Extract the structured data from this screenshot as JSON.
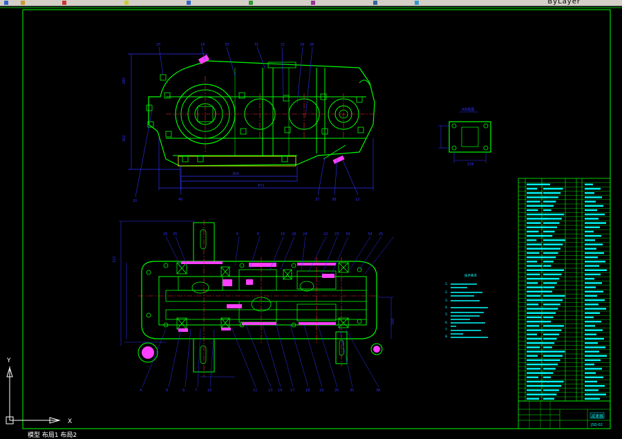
{
  "app": {
    "tab_label": "模型 布局1 布局2",
    "top_right_text": "ByLayer"
  },
  "colors": {
    "background": "#000000",
    "frame": "#00ff00",
    "part": "#00ff00",
    "dimension": "#3030ff",
    "callout": "#00ffff",
    "centerline": "#ff3030",
    "hatch": "#ff40ff",
    "text": "#00ffff",
    "ucs": "#ffffff"
  },
  "icons": [
    "save-icon",
    "undo-icon",
    "redo-icon",
    "pan-icon",
    "zoom-icon",
    "layer-icon",
    "properties-icon",
    "match-icon",
    "help-icon"
  ],
  "top_view": {
    "callouts_top": [
      "25",
      "16",
      "33",
      "31",
      "21",
      "29",
      "28"
    ],
    "callouts_bottom": [
      "40",
      "37",
      "38",
      "12"
    ],
    "callout_left": "20",
    "dims": [
      "280",
      "262",
      "354",
      "871"
    ]
  },
  "section_view": {
    "callouts_top": [
      "26",
      "35",
      "6",
      "8",
      "15",
      "28",
      "24",
      "22",
      "23",
      "34",
      "34",
      "25"
    ],
    "callouts_bottom": [
      "4",
      "8",
      "9",
      "7",
      "10",
      "11",
      "13",
      "14",
      "17",
      "18",
      "19",
      "20",
      "30",
      "38"
    ],
    "dims": [
      "152",
      "190"
    ]
  },
  "side_view": {
    "title": "A向视图",
    "dim": "236"
  },
  "tech_requirements": {
    "title": "技术要求",
    "items": [
      "1.",
      "2.",
      "3.",
      "4.",
      "5.",
      "6.",
      "7.",
      "8."
    ]
  },
  "title_block": {
    "name": "减速器",
    "drawing_no": "JSQ-02"
  },
  "ucs": {
    "x_label": "X",
    "y_label": "Y"
  }
}
